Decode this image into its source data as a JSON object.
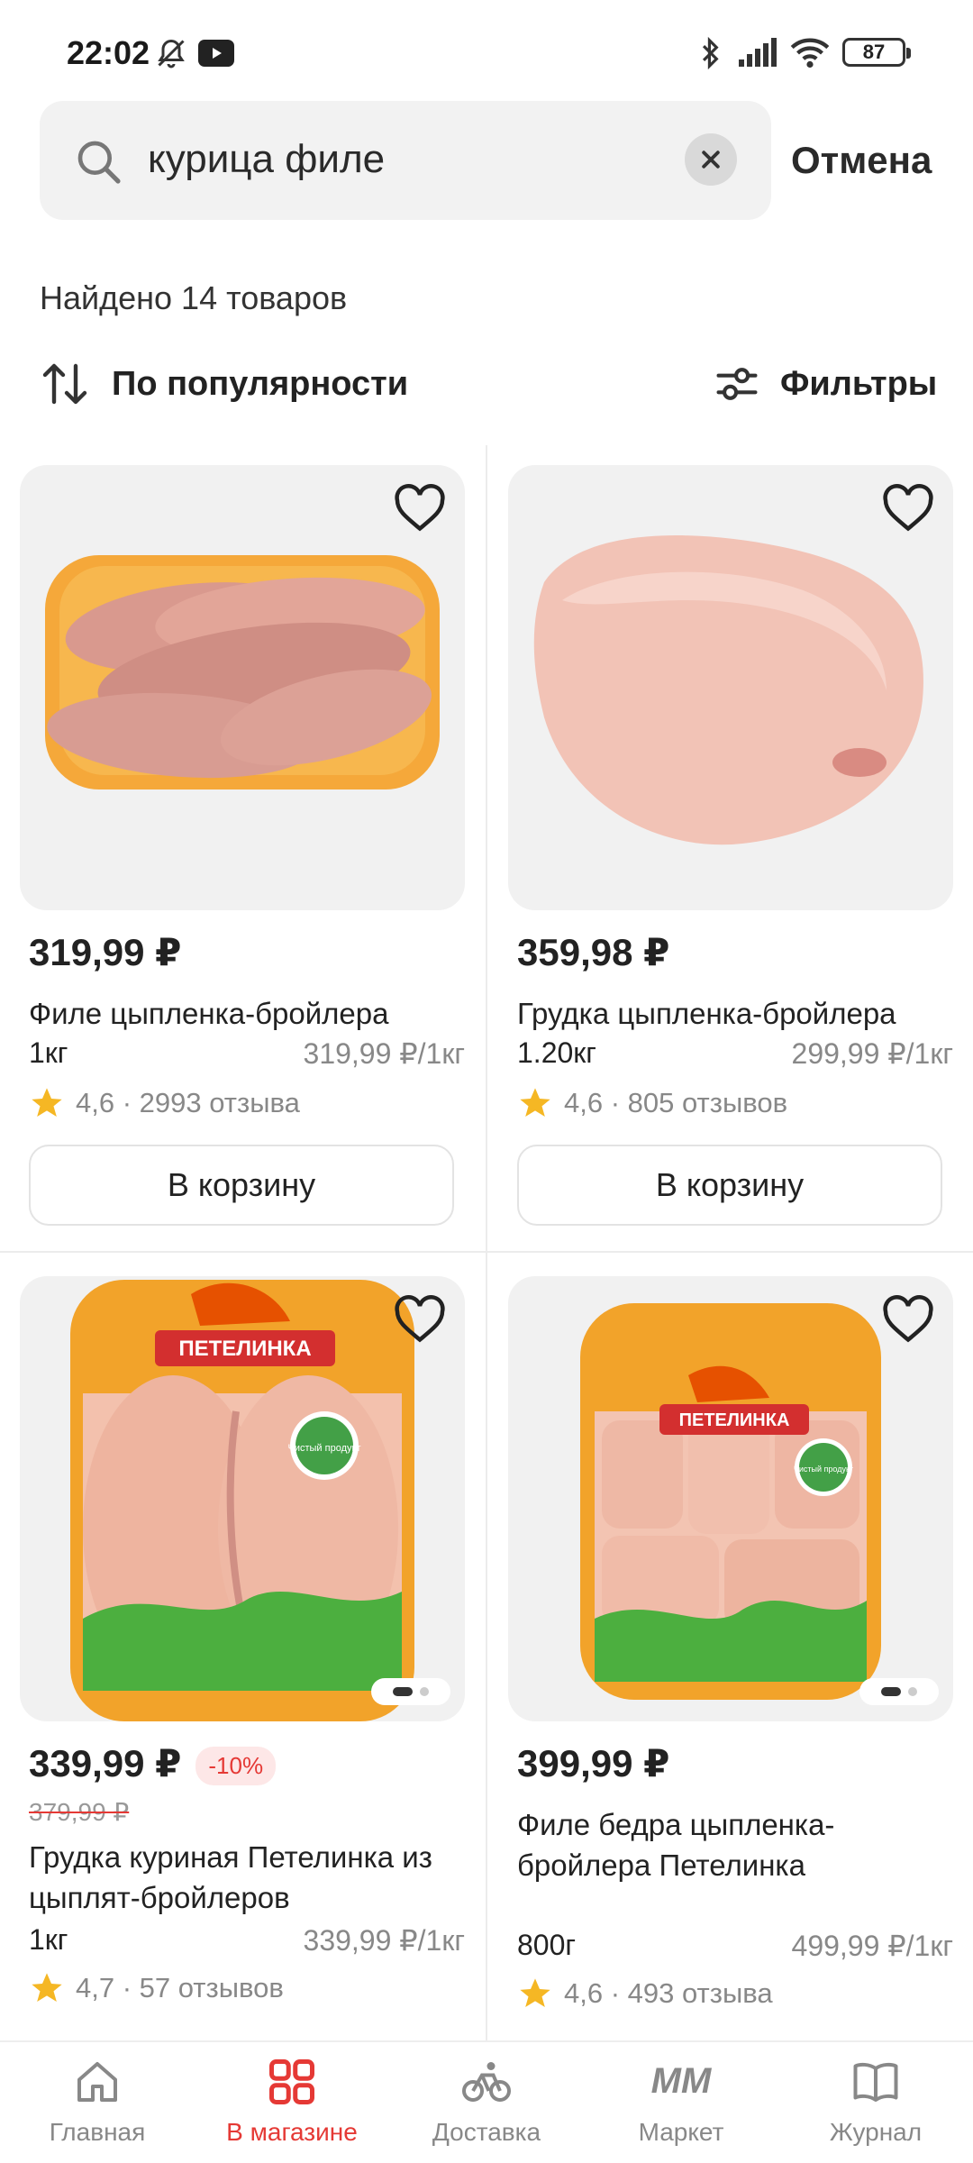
{
  "status": {
    "time": "22:02",
    "battery": "87"
  },
  "search": {
    "query": "курица филе",
    "cancel_label": "Отмена"
  },
  "results": {
    "found_text": "Найдено 14 товаров",
    "sort_label": "По популярности",
    "filters_label": "Фильтры"
  },
  "products": [
    {
      "price": "319,99 ₽",
      "name": "Филе цыпленка-бройлера",
      "weight": "1кг",
      "unit_price": "319,99 ₽/1кг",
      "rating": "4,6 · 2993 отзыва",
      "cart_label": "В корзину"
    },
    {
      "price": "359,98 ₽",
      "name": "Грудка цыпленка-бройлера",
      "weight": "1.20кг",
      "unit_price": "299,99 ₽/1кг",
      "rating": "4,6 · 805 отзывов",
      "cart_label": "В корзину"
    },
    {
      "price": "339,99 ₽",
      "discount": "-10%",
      "old_price": "379,99 ₽",
      "name": "Грудка куриная Петелинка из цыплят-бройлеров",
      "weight": "1кг",
      "unit_price": "339,99 ₽/1кг",
      "rating": "4,7 · 57 отзывов",
      "brand": "ПЕТЕЛИНКА",
      "badge": "Чистый продукт"
    },
    {
      "price": "399,99 ₽",
      "name": "Филе бедра цыпленка-бройлера Петелинка",
      "weight": "800г",
      "unit_price": "499,99 ₽/1кг",
      "rating": "4,6 · 493 отзыва",
      "brand": "ПЕТЕЛИНКА",
      "badge": "Чистый продукт"
    }
  ],
  "nav": [
    {
      "label": "Главная",
      "icon": "home-icon"
    },
    {
      "label": "В магазине",
      "icon": "grid-icon",
      "active": true
    },
    {
      "label": "Доставка",
      "icon": "bike-icon"
    },
    {
      "label": "Маркет",
      "icon": "market-logo",
      "logo_text": "MM"
    },
    {
      "label": "Журнал",
      "icon": "book-icon"
    }
  ],
  "colors": {
    "accent": "#e53935",
    "text": "#222222",
    "muted": "#888888"
  }
}
